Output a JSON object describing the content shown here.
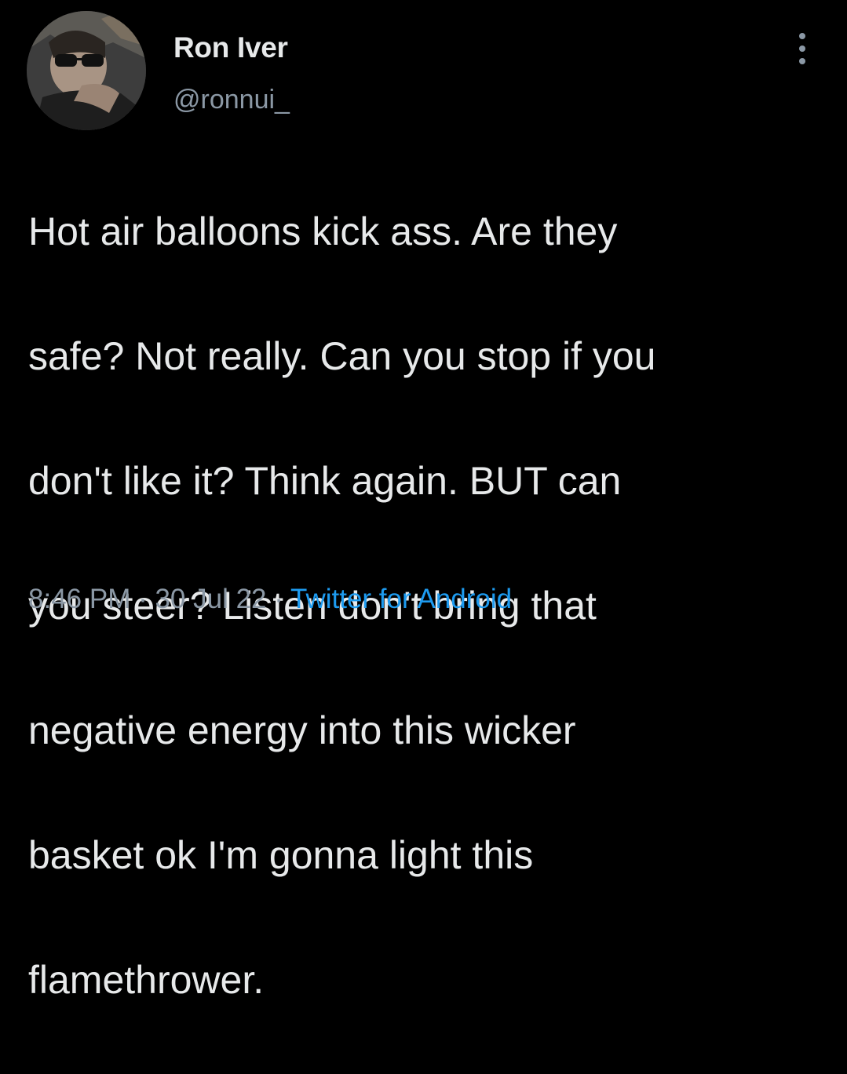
{
  "user": {
    "display_name": "Ron Iver",
    "handle": "@ronnui_",
    "avatar_icon": "profile-photo"
  },
  "menu": {
    "icon": "more-vertical-icon"
  },
  "tweet": {
    "lines": [
      "Hot air balloons kick ass. Are they",
      "safe? Not really. Can you stop if you",
      "don't like it? Think again. BUT can",
      "you steer? Listen don't bring that",
      "negative energy into this wicker",
      "basket ok I'm gonna light this",
      "flamethrower."
    ]
  },
  "meta": {
    "time": "8:46 PM",
    "separator": " · ",
    "date": "30 Jul 22",
    "source": "Twitter for Android"
  },
  "colors": {
    "background": "#000000",
    "text": "#e7e9ea",
    "secondary": "#8b98a5",
    "link": "#1d9bf0"
  }
}
